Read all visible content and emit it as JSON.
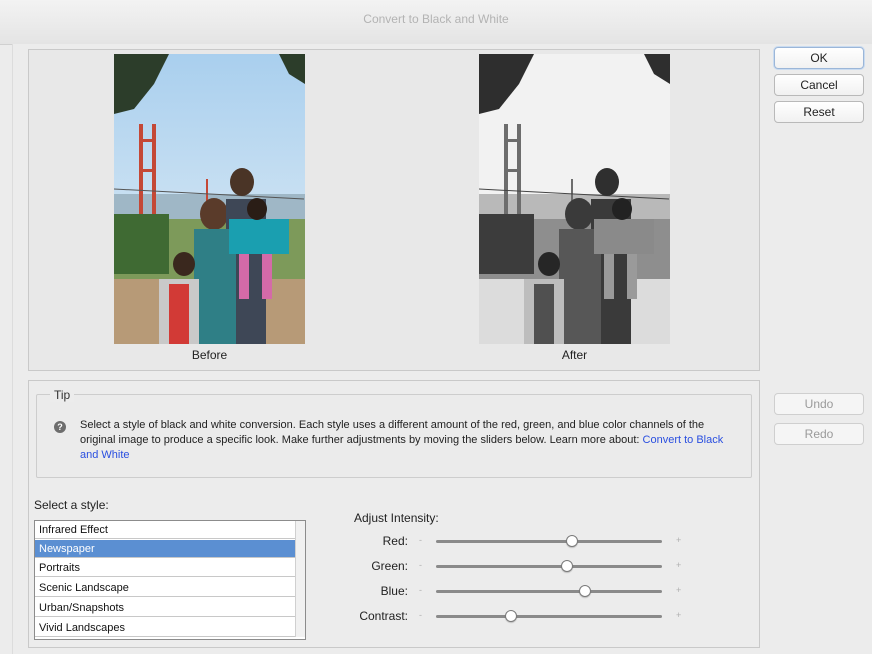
{
  "window": {
    "title": "Convert to Black and White"
  },
  "buttons": {
    "ok": "OK",
    "cancel": "Cancel",
    "reset": "Reset",
    "undo": "Undo",
    "redo": "Redo"
  },
  "preview": {
    "before_label": "Before",
    "after_label": "After"
  },
  "tip": {
    "title": "Tip",
    "icon": "help-icon",
    "text": "Select a style of black and white conversion. Each style uses a different amount of the red, green, and blue color channels of the original image to produce a specific look. Make further adjustments by moving the sliders below. Learn more about: ",
    "link": "Convert to Black and White"
  },
  "styles": {
    "label": "Select a style:",
    "items": [
      "Infrared Effect",
      "Newspaper",
      "Portraits",
      "Scenic Landscape",
      "Urban/Snapshots",
      "Vivid Landscapes"
    ],
    "selected": "Newspaper"
  },
  "intensity": {
    "label": "Adjust Intensity:",
    "minus": "-",
    "plus": "+",
    "sliders": [
      {
        "label": "Red:",
        "value": 0.6
      },
      {
        "label": "Green:",
        "value": 0.58
      },
      {
        "label": "Blue:",
        "value": 0.66
      },
      {
        "label": "Contrast:",
        "value": 0.33
      }
    ]
  },
  "colors": {
    "selection": "#5b8fd2",
    "link": "#2a4fe0"
  }
}
